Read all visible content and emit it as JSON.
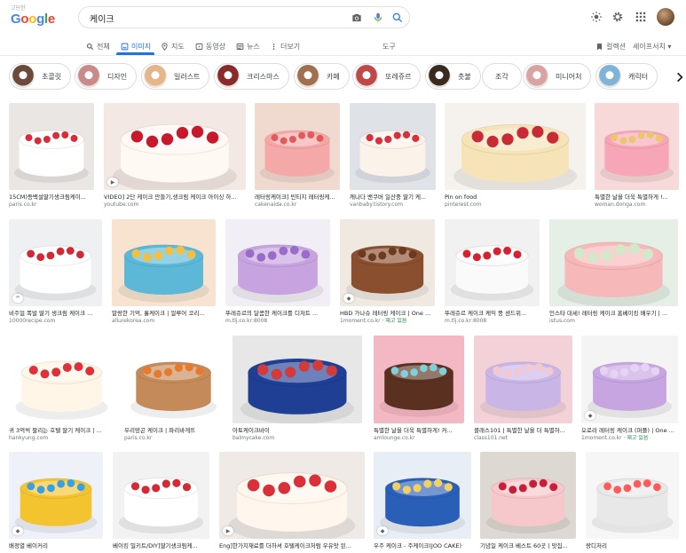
{
  "header": {
    "logo_tag": "고단한",
    "logo": "Google",
    "search_value": "케이크",
    "icons": [
      "camera-icon",
      "mic-icon",
      "search-icon",
      "brightness-icon",
      "settings-icon",
      "apps-icon"
    ]
  },
  "tabs": {
    "items": [
      {
        "label": "전체",
        "icon": "search-icon"
      },
      {
        "label": "이미지",
        "icon": "image-icon",
        "active": true
      },
      {
        "label": "지도",
        "icon": "map-pin-icon"
      },
      {
        "label": "동영상",
        "icon": "video-icon"
      },
      {
        "label": "뉴스",
        "icon": "news-icon"
      },
      {
        "label": "더보기",
        "icon": "more-icon"
      }
    ],
    "tools": "도구",
    "collection": "컬렉션",
    "safesearch": "세이프서치 ▾"
  },
  "chips": [
    {
      "label": "초콜릿",
      "color": "#6b4a3a"
    },
    {
      "label": "디자인",
      "color": "#c98a8a"
    },
    {
      "label": "일러스트",
      "color": "#e6b58a"
    },
    {
      "label": "크리스마스",
      "color": "#8a2a2a"
    },
    {
      "label": "카페",
      "color": "#a07050"
    },
    {
      "label": "또레쥬르",
      "color": "#c04848"
    },
    {
      "label": "촛불",
      "color": "#3a2a20"
    },
    {
      "label": "조각",
      "color": ""
    },
    {
      "label": "미니어처",
      "color": "#d9a3a3"
    },
    {
      "label": "캐릭터",
      "color": "#7fb4d8"
    }
  ],
  "results": [
    {
      "title": "15CM)등백설딸기생크림케이...",
      "source": "paris.co.kr",
      "bg": "#e9e6e4",
      "cake": "#ffffff",
      "top": "#d92b3a"
    },
    {
      "title": "VIDEO] 2단 케이크 만들기,생크림 케이크 아이싱 하...",
      "source": "youtube.com",
      "bg": "#f4e8e4",
      "cake": "#fff8f3",
      "top": "#c8182c"
    },
    {
      "title": "레터링케이크] 빈티지 레터링케...",
      "source": "cakenalda.co.kr",
      "bg": "#f0d9cf",
      "cake": "#f4a8a8",
      "top": "#e25b5b"
    },
    {
      "title": "캐나다 밴쿠버 일산중 딸기 케...",
      "source": "vanbaby.tistory.com",
      "bg": "#dfe3e8",
      "cake": "#fbf3ea",
      "top": "#d8303c"
    },
    {
      "title": "Pin on food",
      "source": "pinterest.com",
      "bg": "#f5f1ed",
      "cake": "#f6e4b8",
      "top": "#c82a36"
    },
    {
      "title": "특별한 날을 더욱 특별하게 !...",
      "source": "woman.donga.com",
      "bg": "#f7d9d9",
      "cake": "#f6a6b6",
      "top": "#e9c76a"
    },
    {
      "title": "비주얼 폭발 딸기 생크림 케이크 ...",
      "source": "10000recipe.com",
      "bg": "#eef0f2",
      "cake": "#ffffff",
      "top": "#d02a36"
    },
    {
      "title": "말랑한 기억, 홀케이크 | 얼루어 코리...",
      "source": "allurekorea.com",
      "bg": "#f7e3d0",
      "cake": "#5cb8d6",
      "top": "#f1c040"
    },
    {
      "title": "뚜레쥬르의 달콤한 케이크를 디저트 ...",
      "source": "m.tlj.co.kr:8008",
      "bg": "#f1eef5",
      "cake": "#c7a3e0",
      "top": "#9a6cc8"
    },
    {
      "title": "HBD 가나슈 레터링 케이크 | One ...",
      "source": "1moment.co.kr",
      "source_sub": " · 재고 있음",
      "bg": "#efe9e2",
      "cake": "#8a4f2e",
      "top": "#6b3a20"
    },
    {
      "title": "뚜레쥬르 케이크 케익 뚱 샌드위...",
      "source": "m.tlj.co.kr:8008",
      "bg": "#f1f1f1",
      "cake": "#fafafa",
      "top": "#d4232f"
    },
    {
      "title": "인스타 대세! 레터링 케이크 홈베이킹 배우기 | ...",
      "source": "istus.com",
      "bg": "#e6efe6",
      "cake": "#f6b8b8",
      "top": "#d3e8c8"
    },
    {
      "title": "귀 3억씩 팔리는 호텔 딸기 케이크 | ...",
      "source": "hankyung.com",
      "bg": "#ffffff",
      "cake": "#fff6e8",
      "top": "#e0303a"
    },
    {
      "title": "우리망곤 케이크 | 파리바게뜨",
      "source": "paris.co.kr",
      "bg": "#ffffff",
      "cake": "#c58a5a",
      "top": "#e8792b"
    },
    {
      "title": "아토케이크바이",
      "source": "balmycake.com",
      "bg": "#e7e7e7",
      "cake": "#1f3f95",
      "top": "#d33a3a"
    },
    {
      "title": "특별한 날을 더욱 특별하게! 커...",
      "source": "amlounge.co.kr",
      "bg": "#f4b8c4",
      "cake": "#5a3020",
      "top": "#7fd0d8"
    },
    {
      "title": "클래스101 | 특별한 날을 더 특별하...",
      "source": "class101.net",
      "bg": "#f2d2d8",
      "cake": "#c9b5e6",
      "top": "#f4c7d1"
    },
    {
      "title": "오로라 레터링 케이크 (퍼플) | One ...",
      "source": "1moment.co.kr",
      "source_sub": " · 재고 있음",
      "bg": "#f4f4f4",
      "cake": "#c6a5e0",
      "top": "#e6d3f4"
    },
    {
      "title": "배정열 베이커리",
      "source": "",
      "bg": "#eef2f8",
      "cake": "#f4c430",
      "top": "#3aa0e0"
    },
    {
      "title": "베이킹 밀키트/DIY]딸기생크림케...",
      "source": "",
      "bg": "#f2f2f2",
      "cake": "#ffffff",
      "top": "#d42a36"
    },
    {
      "title": "Eng]한가지재료를 더하셔 호텔케이크처럼 우유맛 된...",
      "source": "",
      "bg": "#efeae6",
      "cake": "#fff6ee",
      "top": "#d9303a"
    },
    {
      "title": "우주 케이크 - 주케이크(JOO CAKE)",
      "source": "",
      "bg": "#e8eef5",
      "cake": "#2a5fb8",
      "top": "#f4d060"
    },
    {
      "title": "기념일 케이크 베스트 60곳 | 맛집...",
      "source": "",
      "bg": "#ded8d2",
      "cake": "#f6c8cc",
      "top": "#c81e3a"
    },
    {
      "title": "랑디저리",
      "source": "",
      "bg": "#f6f6f6",
      "cake": "#e8e8e8",
      "top": "#ff5a5a"
    }
  ]
}
